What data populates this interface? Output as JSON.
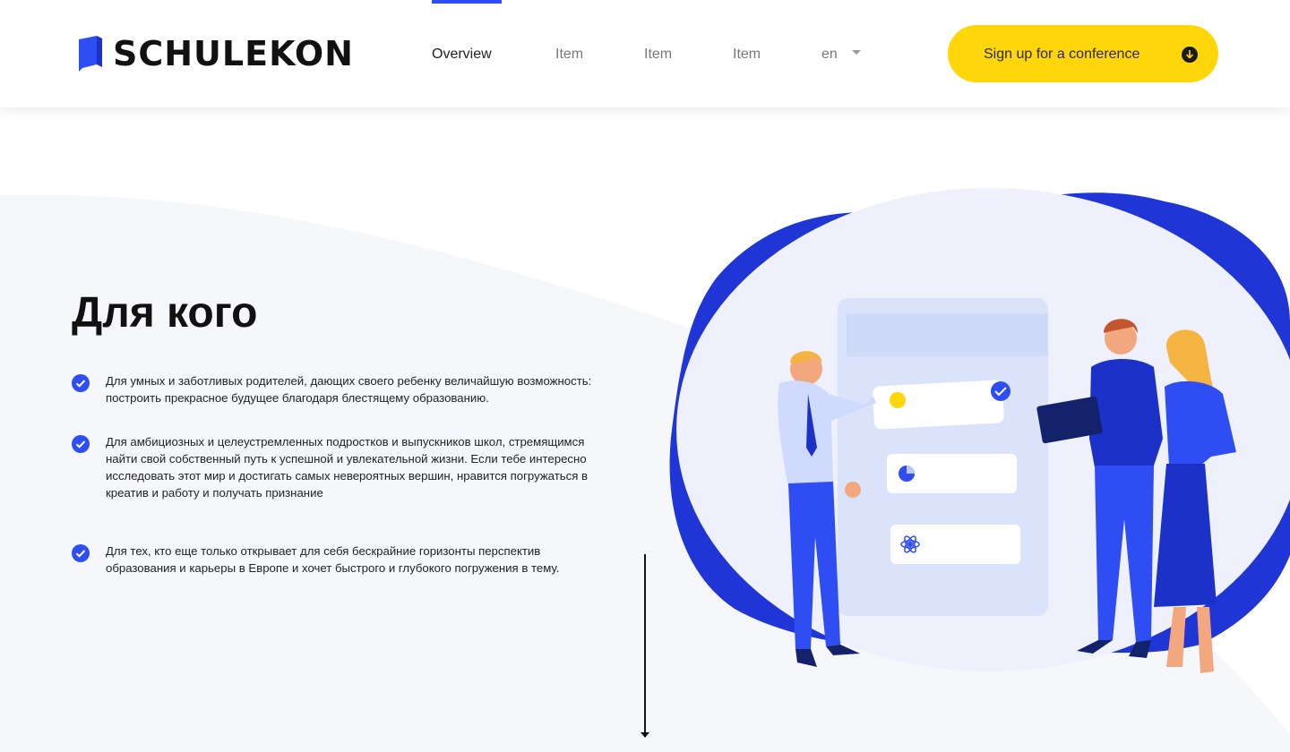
{
  "header": {
    "logo_text": "SCHULEKON",
    "nav": [
      {
        "label": "Overview",
        "active": true
      },
      {
        "label": "Item",
        "active": false
      },
      {
        "label": "Item",
        "active": false
      },
      {
        "label": "Item",
        "active": false
      }
    ],
    "language": "en",
    "cta_label": "Sign up for a conference"
  },
  "section": {
    "title": "Для кого",
    "features": [
      {
        "text": "Для умных и заботливых родителей, дающих своего ребенку величайшую возможность: построить прекрасное будущее благодаря блестящему образованию."
      },
      {
        "text": "Для амбициозных и целеустремленных подростков и выпускников школ, стремящимся найти свой собственный путь к успешной и увлекательной жизни. Если тебе интересно исследовать этот мир и достигать самых невероятных вершин, нравится погружаться в креатив и работу и получать признание"
      },
      {
        "text": "Для тех, кто еще только открывает для себя бескрайние горизонты перспектив образования и карьеры в Европе и хочет быстрого и глубокого погружения в тему."
      }
    ]
  },
  "colors": {
    "accent": "#2e4df2",
    "cta": "#ffd60a",
    "section_bg": "#f6f7fb",
    "blob": "#1f35d6"
  },
  "icons": {
    "cta": "download-arrow-icon",
    "feature": "check-circle-icon",
    "lang": "caret-down-icon"
  }
}
